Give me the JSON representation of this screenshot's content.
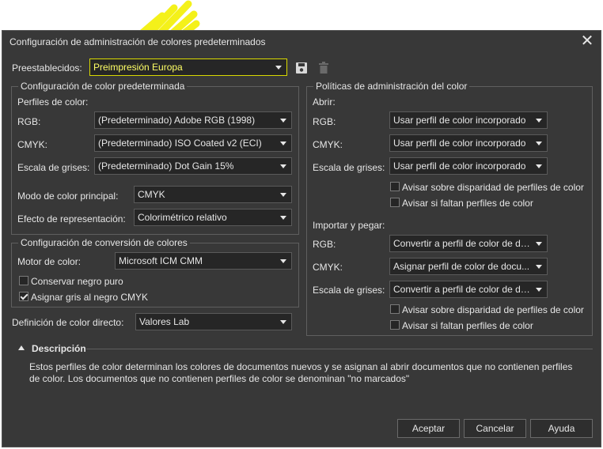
{
  "dialog": {
    "title": "Configuración de administración de colores predeterminados"
  },
  "preset": {
    "label": "Preestablecidos:",
    "value": "Preimpresión Europa"
  },
  "default_config": {
    "legend": "Configuración de color predeterminada",
    "profiles_label": "Perfiles de color:",
    "rgb_label": "RGB:",
    "rgb_value": "(Predeterminado) Adobe RGB (1998)",
    "cmyk_label": "CMYK:",
    "cmyk_value": "(Predeterminado) ISO Coated v2 (ECI)",
    "gray_label": "Escala de grises:",
    "gray_value": "(Predeterminado) Dot Gain 15%",
    "primary_mode_label": "Modo de color principal:",
    "primary_mode_value": "CMYK",
    "intent_label": "Efecto de representación:",
    "intent_value": "Colorimétrico relativo"
  },
  "conversion": {
    "legend": "Configuración de conversión de colores",
    "engine_label": "Motor de color:",
    "engine_value": "Microsoft ICM CMM",
    "preserve_black_label": "Conservar negro puro",
    "preserve_black_checked": false,
    "map_gray_label": "Asignar gris al negro CMYK",
    "map_gray_checked": true
  },
  "spot": {
    "label": "Definición de color directo:",
    "value": "Valores Lab"
  },
  "policies": {
    "legend": "Políticas de administración del color",
    "open_label": "Abrir:",
    "open_rgb_label": "RGB:",
    "open_rgb_value": "Usar perfil de color incorporado",
    "open_cmyk_label": "CMYK:",
    "open_cmyk_value": "Usar perfil de color incorporado",
    "open_gray_label": "Escala de grises:",
    "open_gray_value": "Usar perfil de color incorporado",
    "open_warn_mismatch": "Avisar sobre disparidad de perfiles de color",
    "open_warn_missing": "Avisar si faltan perfiles de color",
    "import_label": "Importar y pegar:",
    "import_rgb_label": "RGB:",
    "import_rgb_value": "Convertir a perfil de color de do...",
    "import_cmyk_label": "CMYK:",
    "import_cmyk_value": "Asignar perfil de color de docu...",
    "import_gray_label": "Escala de grises:",
    "import_gray_value": "Convertir a perfil de color de do...",
    "import_warn_mismatch": "Avisar sobre disparidad de perfiles de color",
    "import_warn_missing": "Avisar si faltan perfiles de color"
  },
  "description": {
    "header": "Descripción",
    "text": "Estos perfiles de color determinan los colores de documentos nuevos y se asignan al abrir documentos que no contienen perfiles de color. Los documentos que no contienen perfiles de color se denominan \"no marcados\""
  },
  "buttons": {
    "ok": "Aceptar",
    "cancel": "Cancelar",
    "help": "Ayuda"
  },
  "colors": {
    "background": "#383838",
    "field": "#262626",
    "preset_highlight": "#d9d900"
  }
}
